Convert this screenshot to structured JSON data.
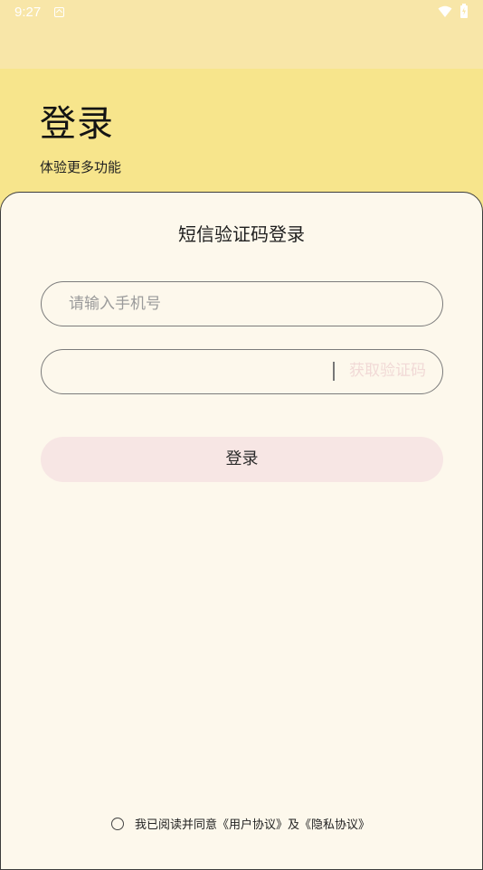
{
  "status_bar": {
    "time": "9:27",
    "icons": [
      "a-notification-icon",
      "wifi-icon",
      "battery-icon"
    ]
  },
  "header": {
    "title": "登录",
    "subtitle": "体验更多功能"
  },
  "card": {
    "title": "短信验证码登录",
    "phone": {
      "placeholder": "请输入手机号",
      "value": ""
    },
    "code": {
      "placeholder": "",
      "value": "",
      "get_code_label": "获取验证码"
    },
    "login_label": "登录",
    "agreement": {
      "prefix": "我已阅读并同意",
      "user_agreement": "《用户协议》",
      "joiner": "及",
      "privacy_policy": "《隐私协议》",
      "checked": false
    }
  },
  "colors": {
    "header_bg": "#F7E58C",
    "status_bg": "#F8E6A8",
    "card_bg": "#FDF8EC",
    "login_button_bg": "#F7E6E4",
    "get_code_text": "#F1D9D6"
  }
}
